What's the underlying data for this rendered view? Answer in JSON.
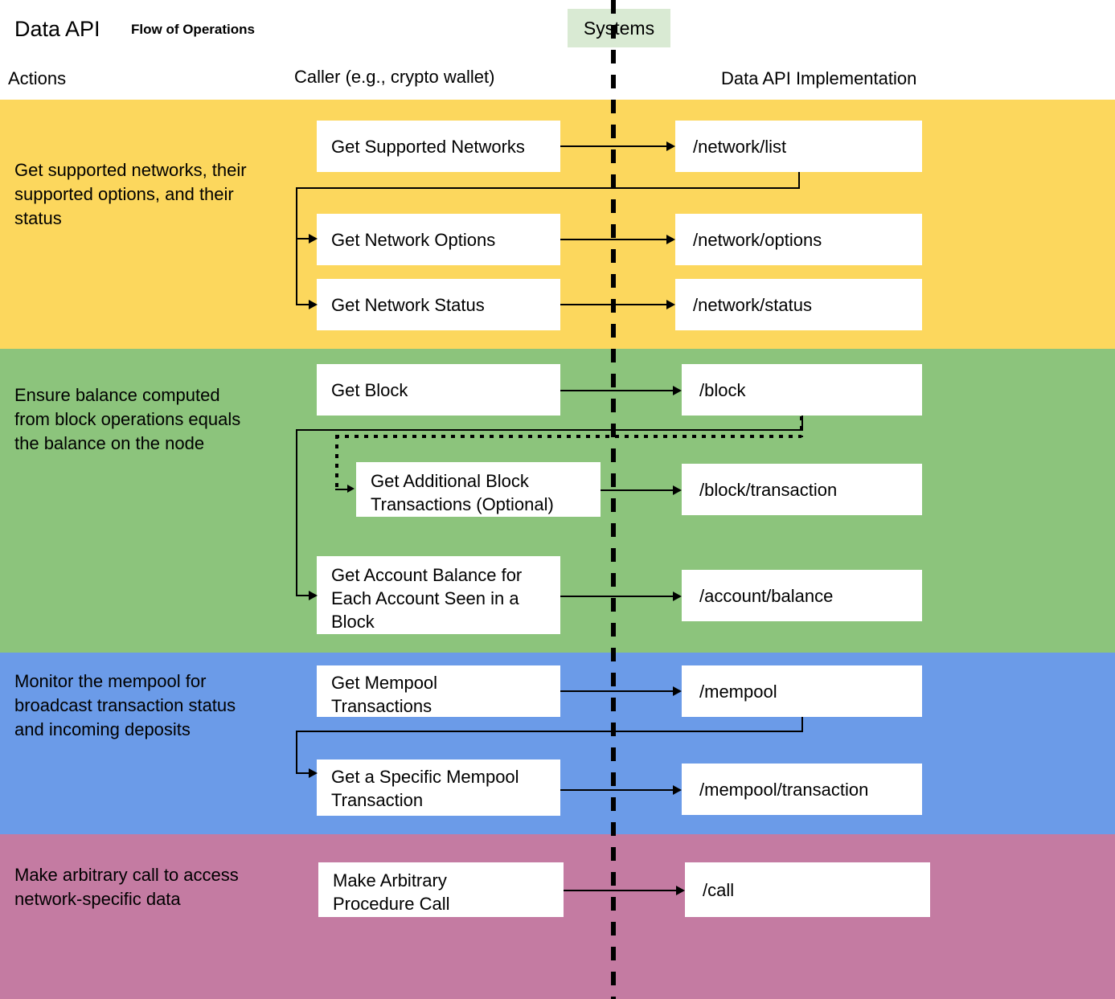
{
  "header": {
    "title": "Data API",
    "subtitle": "Flow of Operations",
    "systems_label": "Systems",
    "columns": {
      "actions": "Actions",
      "caller": "Caller (e.g., crypto wallet)",
      "implementation": "Data API Implementation"
    }
  },
  "colors": {
    "band_yellow": "#fcd75d",
    "band_green": "#8cc47c",
    "band_blue": "#6b9be8",
    "band_pink": "#c47ba2",
    "systems_chip": "#d9ead3",
    "node_fill": "#ffffff",
    "connector": "#000000"
  },
  "lanes": [
    {
      "id": "networks",
      "color": "#fcd75d",
      "action": "Get supported networks, their\nsupported options, and their\nstatus",
      "caller_nodes": [
        "Get Supported Networks",
        "Get Network Options",
        "Get Network Status"
      ],
      "endpoint_nodes": [
        "/network/list",
        "/network/options",
        "/network/status"
      ]
    },
    {
      "id": "balance",
      "color": "#8cc47c",
      "action": "Ensure balance computed\nfrom block operations equals\nthe balance on the node",
      "caller_nodes": [
        "Get Block",
        "Get Additional Block\nTransactions (Optional)",
        "Get Account Balance for\nEach Account Seen in a\nBlock"
      ],
      "endpoint_nodes": [
        "/block",
        "/block/transaction",
        "/account/balance"
      ]
    },
    {
      "id": "mempool",
      "color": "#6b9be8",
      "action": "Monitor the mempool for\nbroadcast transaction status\nand incoming deposits",
      "caller_nodes": [
        "Get Mempool\nTransactions",
        "Get a Specific Mempool\nTransaction"
      ],
      "endpoint_nodes": [
        "/mempool",
        "/mempool/transaction"
      ]
    },
    {
      "id": "call",
      "color": "#c47ba2",
      "action": "Make arbitrary call to access\nnetwork-specific data",
      "caller_nodes": [
        "Make Arbitrary\nProcedure Call"
      ],
      "endpoint_nodes": [
        "/call"
      ]
    }
  ]
}
